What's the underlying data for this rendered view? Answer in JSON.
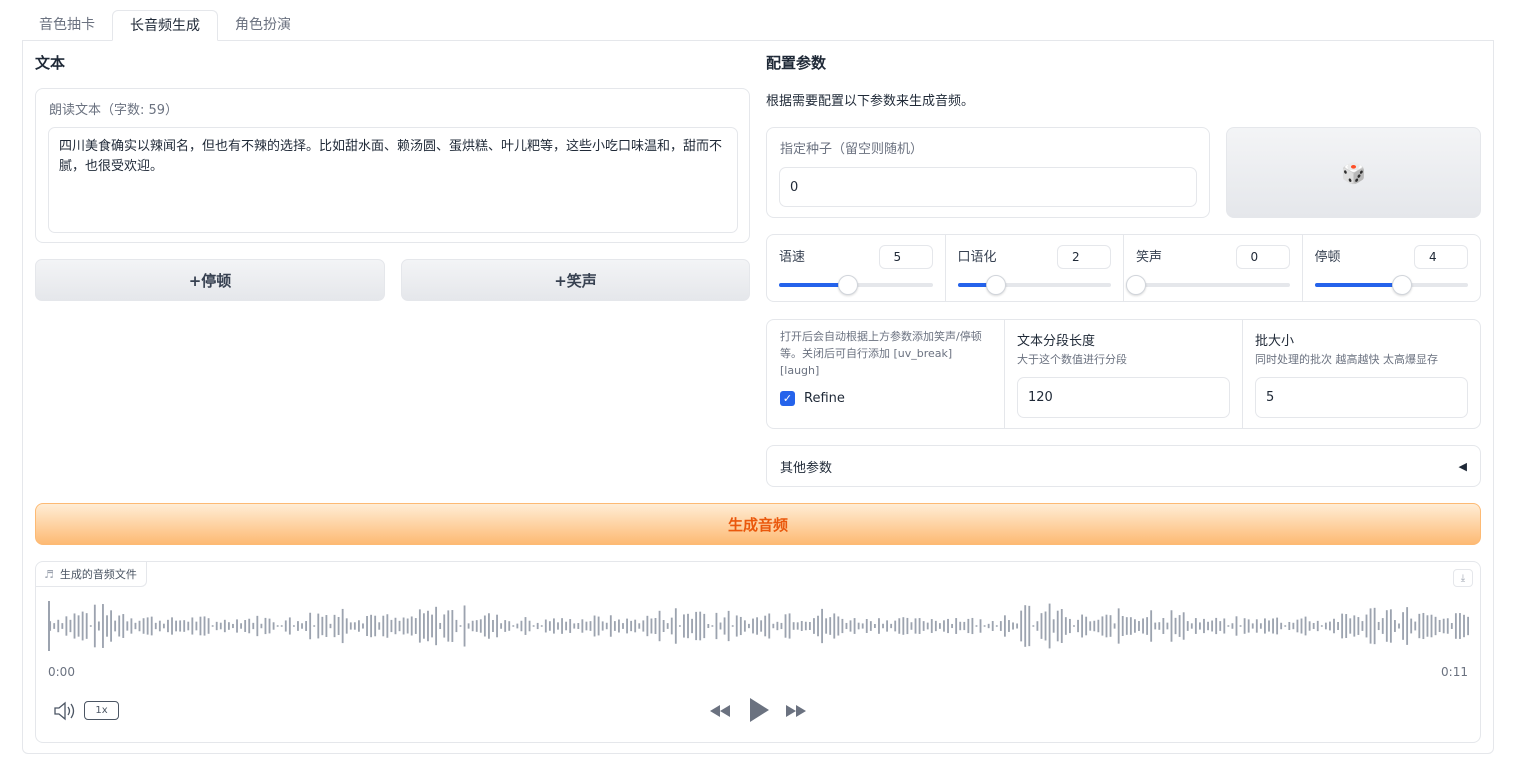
{
  "tabs": [
    {
      "label": "音色抽卡",
      "active": false
    },
    {
      "label": "长音频生成",
      "active": true
    },
    {
      "label": "角色扮演",
      "active": false
    }
  ],
  "left": {
    "title": "文本",
    "text_label": "朗读文本（字数: 59）",
    "text_value": "四川美食确实以辣闻名，但也有不辣的选择。比如甜水面、赖汤圆、蛋烘糕、叶儿粑等，这些小吃口味温和，甜而不腻，也很受欢迎。",
    "btn_pause": "+停顿",
    "btn_laugh": "+笑声"
  },
  "right": {
    "title": "配置参数",
    "description": "根据需要配置以下参数来生成音频。",
    "seed_label": "指定种子（留空则随机）",
    "seed_value": "0",
    "dice_icon": "🎲",
    "sliders": [
      {
        "label": "语速",
        "value": "5",
        "fraction": 0.45
      },
      {
        "label": "口语化",
        "value": "2",
        "fraction": 0.25
      },
      {
        "label": "笑声",
        "value": "0",
        "fraction": 0.0
      },
      {
        "label": "停顿",
        "value": "4",
        "fraction": 0.57
      }
    ],
    "refine_hint": "打开后会自动根据上方参数添加笑声/停顿等。关闭后可自行添加 [uv_break] [laugh]",
    "refine_label": "Refine",
    "refine_checked": true,
    "segment_title": "文本分段长度",
    "segment_hint": "大于这个数值进行分段",
    "segment_value": "120",
    "batch_title": "批大小",
    "batch_hint": "同时处理的批次 越高越快 太高爆显存",
    "batch_value": "5",
    "other_params": "其他参数",
    "other_params_arrow": "◀"
  },
  "generate_label": "生成音频",
  "audio": {
    "label": "生成的音频文件",
    "time_start": "0:00",
    "time_end": "0:11",
    "rate": "1x"
  },
  "colors": {
    "accent": "#2563eb",
    "generate_text": "#ea580c",
    "generate_bg": "#fdba74",
    "wave": "#9ca3af"
  }
}
